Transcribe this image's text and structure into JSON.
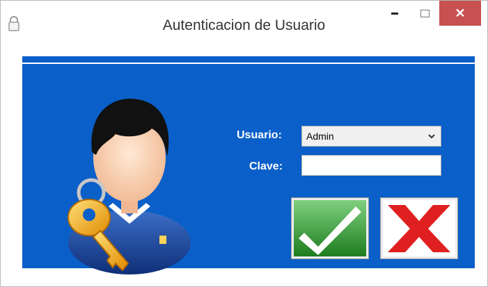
{
  "window": {
    "title": "Autenticacion de Usuario",
    "close_glyph": "✕"
  },
  "form": {
    "user_label": "Usuario:",
    "user_selected": "Admin",
    "password_label": "Clave:",
    "password_value": ""
  },
  "icons": {
    "app": "lock-icon",
    "avatar": "user-with-key-icon",
    "accept": "checkmark-icon",
    "cancel": "red-x-icon",
    "dropdown": "chevron-down-icon"
  },
  "colors": {
    "panel": "#0a5fc9",
    "close_button": "#c75050",
    "accept": "#2e9a2e",
    "cancel": "#e02020"
  }
}
